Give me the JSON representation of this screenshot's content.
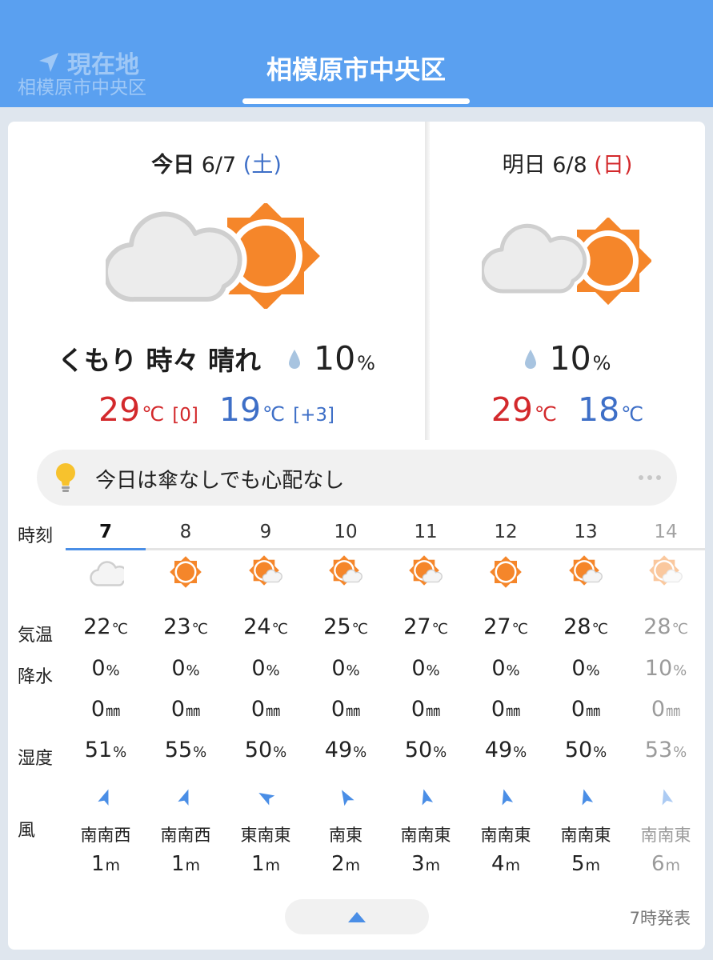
{
  "header": {
    "location_tab": {
      "title": "現在地",
      "subtitle": "相模原市中央区"
    },
    "city_tab": "相模原市中央区"
  },
  "today": {
    "label": "今日",
    "date": "6/7",
    "dow": "(土)",
    "weather": "くもり 時々 晴れ",
    "precip_prob": "10",
    "precip_unit": "%",
    "high": "29",
    "high_unit": "℃",
    "high_diff": "[0]",
    "low": "19",
    "low_unit": "℃",
    "low_diff": "[+3]",
    "icon": "cloudy-sometimes-sunny"
  },
  "tomorrow": {
    "label": "明日",
    "date": "6/8",
    "dow": "(日)",
    "precip_prob": "10",
    "precip_unit": "%",
    "high": "29",
    "high_unit": "℃",
    "low": "18",
    "low_unit": "℃",
    "icon": "cloudy-sometimes-sunny"
  },
  "tip": {
    "text": "今日は傘なしでも心配なし"
  },
  "hourly": {
    "labels": {
      "time": "時刻",
      "temp": "気温",
      "precip": "降水",
      "humidity": "湿度",
      "wind": "風"
    },
    "temp_unit": "℃",
    "pct_unit": "%",
    "mm_unit": "㎜",
    "wind_unit": "m",
    "hours": [
      {
        "hour": "7",
        "icon": "cloud",
        "temp": "22",
        "prob": "0",
        "mm": "0",
        "humidity": "51",
        "dir": "南南西",
        "speed": "1"
      },
      {
        "hour": "8",
        "icon": "sun",
        "temp": "23",
        "prob": "0",
        "mm": "0",
        "humidity": "55",
        "dir": "南南西",
        "speed": "1"
      },
      {
        "hour": "9",
        "icon": "sun-cloud",
        "temp": "24",
        "prob": "0",
        "mm": "0",
        "humidity": "50",
        "dir": "東南東",
        "speed": "1"
      },
      {
        "hour": "10",
        "icon": "sun-cloud",
        "temp": "25",
        "prob": "0",
        "mm": "0",
        "humidity": "49",
        "dir": "南東",
        "speed": "2"
      },
      {
        "hour": "11",
        "icon": "sun-cloud",
        "temp": "27",
        "prob": "0",
        "mm": "0",
        "humidity": "50",
        "dir": "南南東",
        "speed": "3"
      },
      {
        "hour": "12",
        "icon": "sun",
        "temp": "27",
        "prob": "0",
        "mm": "0",
        "humidity": "49",
        "dir": "南南東",
        "speed": "4"
      },
      {
        "hour": "13",
        "icon": "sun-cloud",
        "temp": "28",
        "prob": "0",
        "mm": "0",
        "humidity": "50",
        "dir": "南南東",
        "speed": "5"
      },
      {
        "hour": "14",
        "icon": "sun-cloud",
        "temp": "28",
        "prob": "10",
        "mm": "0",
        "humidity": "53",
        "dir": "南南東",
        "speed": "6"
      }
    ]
  },
  "footer": {
    "issued": "7時発表",
    "collapse_icon": "triangle-up-icon"
  },
  "colors": {
    "header_bg": "#5aa0f0",
    "accent": "#4a8ee6",
    "high_temp": "#d3292c",
    "low_temp": "#3e6fc7",
    "sun": "#f5862a",
    "cloud": "#e0e0e0"
  }
}
